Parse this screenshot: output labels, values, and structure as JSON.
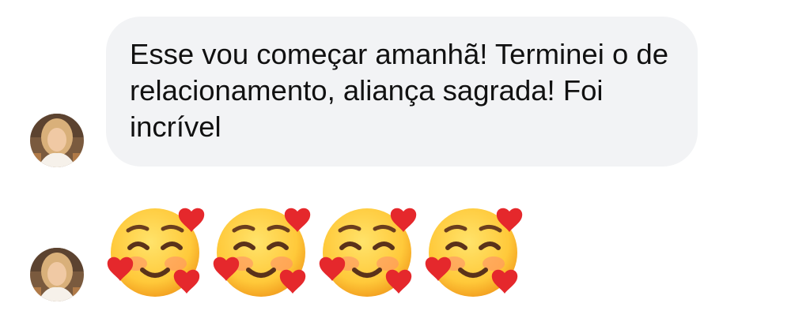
{
  "conversation": {
    "messages": [
      {
        "text": "Esse vou começar amanhã! Terminei o de relacionamento, aliança sagrada! Foi incrível"
      },
      {
        "emojis": [
          "smiling-face-with-hearts",
          "smiling-face-with-hearts",
          "smiling-face-with-hearts",
          "smiling-face-with-hearts"
        ]
      }
    ]
  },
  "colors": {
    "bubble_background": "#f2f3f5",
    "text": "#111111",
    "emoji_face": "#ffc93a",
    "emoji_heart": "#e5282c"
  }
}
